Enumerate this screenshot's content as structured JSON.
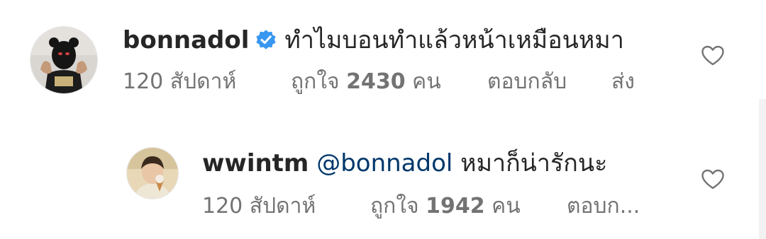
{
  "colors": {
    "text": "#262626",
    "secondary": "#737373",
    "mention": "#00376b",
    "verified_badge": "#3897f0"
  },
  "comments": [
    {
      "username": "bonnadol",
      "verified": true,
      "mention": "",
      "text": "ทำไมบอนทำแล้วหน้าเหมือนหมา",
      "time": "120 สัปดาห์",
      "likes_prefix": "ถูกใจ",
      "likes_count": "2430",
      "likes_suffix": "คน",
      "reply_label": "ตอบกลับ",
      "send_label": "ส่ง",
      "avatar_icon": "masked-person-avatar",
      "like_icon": "heart-outline-icon"
    },
    {
      "username": "wwintm",
      "verified": false,
      "mention": "@bonnadol",
      "text": "หมาก็น่ารักนะ",
      "time": "120 สัปดาห์",
      "likes_prefix": "ถูกใจ",
      "likes_count": "1942",
      "likes_suffix": "คน",
      "reply_label": "ตอบก...",
      "avatar_icon": "person-eating-icecream-avatar",
      "like_icon": "heart-outline-icon"
    }
  ]
}
